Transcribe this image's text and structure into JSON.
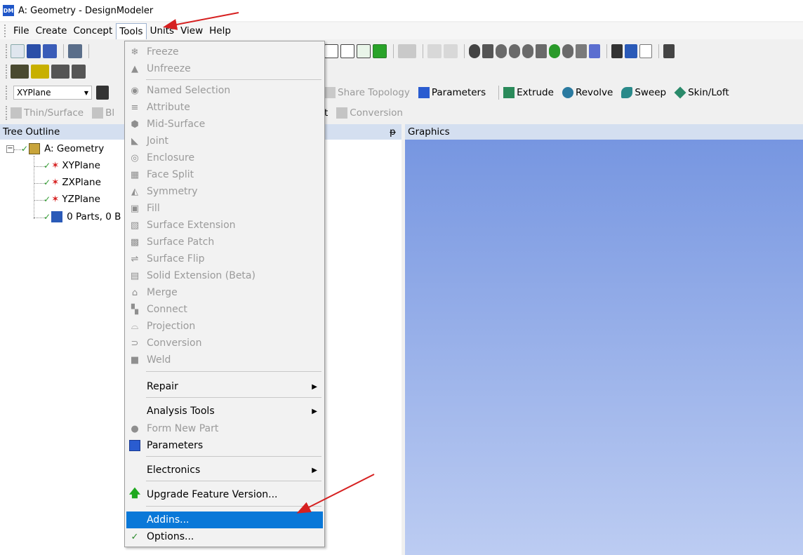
{
  "window": {
    "title": "A: Geometry - DesignModeler",
    "app_badge": "DM"
  },
  "menubar": [
    {
      "label": "File"
    },
    {
      "label": "Create"
    },
    {
      "label": "Concept"
    },
    {
      "label": "Tools"
    },
    {
      "label": "Units"
    },
    {
      "label": "View"
    },
    {
      "label": "Help"
    }
  ],
  "toolbar": {
    "plane_select": "XYPlane",
    "share_topology": "Share Topology",
    "parameters": "Parameters",
    "extrude": "Extrude",
    "revolve": "Revolve",
    "sweep": "Sweep",
    "skin_loft": "Skin/Loft",
    "thin_surface": "Thin/Surface",
    "blend_partial": "Bl",
    "point_partial": "t",
    "conversion": "Conversion"
  },
  "tree": {
    "header": "Tree Outline",
    "pin": "ᵽ",
    "items": [
      {
        "label": "A: Geometry"
      },
      {
        "label": "XYPlane"
      },
      {
        "label": "ZXPlane"
      },
      {
        "label": "YZPlane"
      },
      {
        "label": "0 Parts, 0 B"
      }
    ]
  },
  "graphics": {
    "header": "Graphics"
  },
  "tools_menu": {
    "items": [
      {
        "label": "Freeze",
        "disabled": true
      },
      {
        "label": "Unfreeze",
        "disabled": true
      },
      {
        "label": "Named Selection",
        "disabled": true
      },
      {
        "label": "Attribute",
        "disabled": true
      },
      {
        "label": "Mid-Surface",
        "disabled": true
      },
      {
        "label": "Joint",
        "disabled": true
      },
      {
        "label": "Enclosure",
        "disabled": true
      },
      {
        "label": "Face Split",
        "disabled": true
      },
      {
        "label": "Symmetry",
        "disabled": true
      },
      {
        "label": "Fill",
        "disabled": true
      },
      {
        "label": "Surface Extension",
        "disabled": true
      },
      {
        "label": "Surface Patch",
        "disabled": true
      },
      {
        "label": "Surface Flip",
        "disabled": true
      },
      {
        "label": "Solid Extension (Beta)",
        "disabled": true
      },
      {
        "label": "Merge",
        "disabled": true
      },
      {
        "label": "Connect",
        "disabled": true
      },
      {
        "label": "Projection",
        "disabled": true
      },
      {
        "label": "Conversion",
        "disabled": true
      },
      {
        "label": "Weld",
        "disabled": true
      },
      {
        "label": "Repair",
        "submenu": true
      },
      {
        "label": "Analysis Tools",
        "submenu": true
      },
      {
        "label": "Form New Part",
        "disabled": true
      },
      {
        "label": "Parameters"
      },
      {
        "label": "Electronics",
        "submenu": true
      },
      {
        "label": "Upgrade Feature Version..."
      },
      {
        "label": "Addins...",
        "highlighted": true
      },
      {
        "label": "Options..."
      }
    ]
  },
  "colors": {
    "highlight": "#0a78d8",
    "annotation_arrow": "#d62020",
    "graphics_top": "#7494e0",
    "graphics_bottom": "#bcccf2"
  }
}
